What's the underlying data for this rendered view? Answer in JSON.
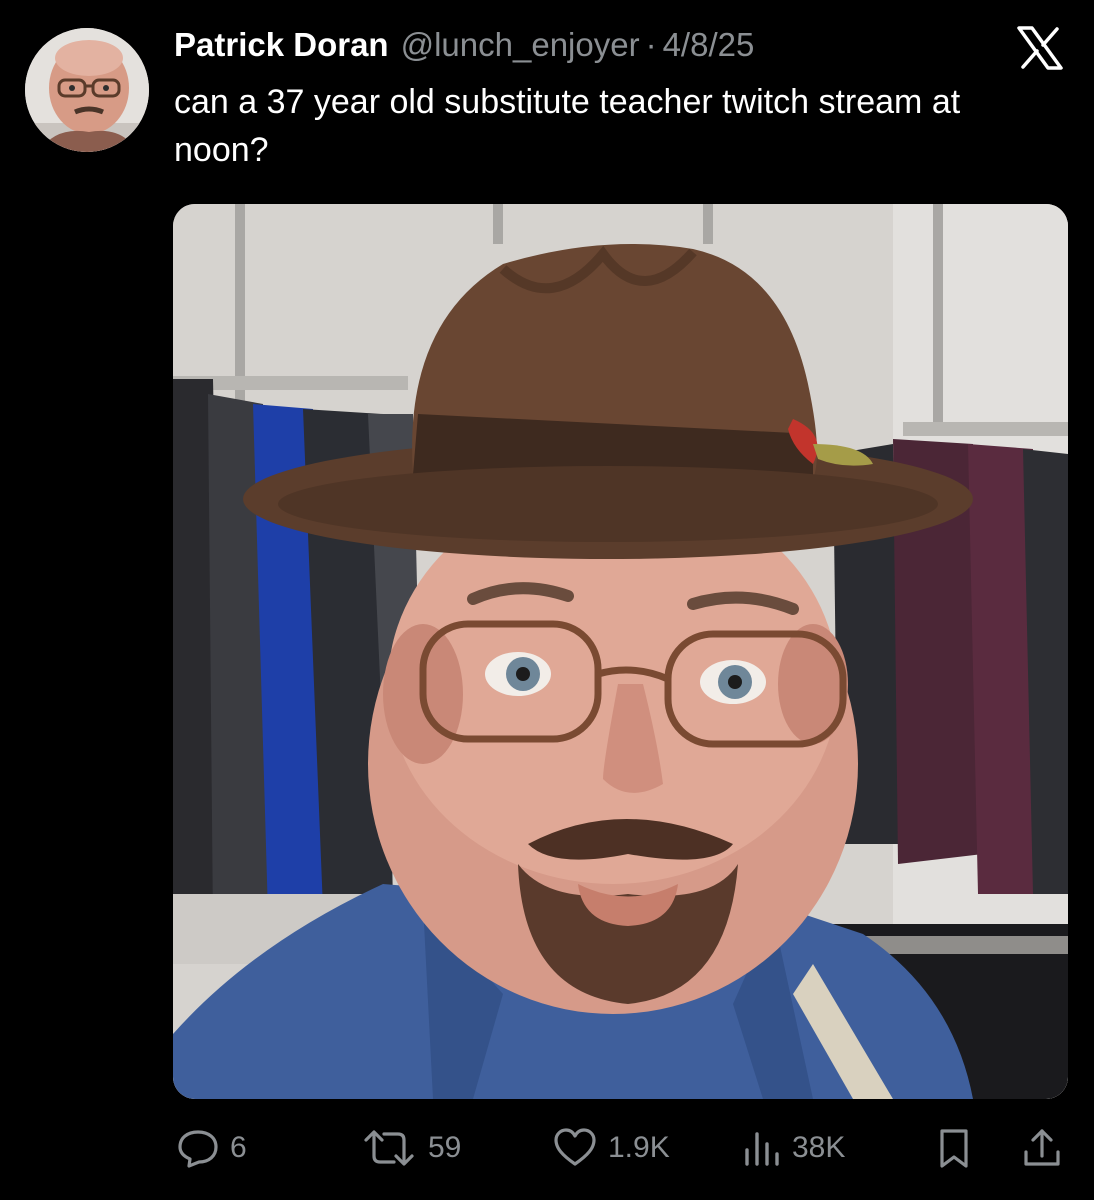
{
  "tweet": {
    "author": {
      "display_name": "Patrick Doran",
      "handle": "@lunch_enjoyer",
      "avatar": "profile-photo"
    },
    "separator": "·",
    "date": "4/8/25",
    "text": "can a 37 year old substitute teacher twitch stream at noon?",
    "media": {
      "type": "photo",
      "description_icon": "selfie-photo"
    },
    "platform_icon": "x-logo-icon"
  },
  "actions": {
    "replies": {
      "icon": "reply-icon",
      "count": "6"
    },
    "reposts": {
      "icon": "repost-icon",
      "count": "59"
    },
    "likes": {
      "icon": "heart-icon",
      "count": "1.9K"
    },
    "views": {
      "icon": "views-icon",
      "count": "38K"
    },
    "bookmark": {
      "icon": "bookmark-icon"
    },
    "share": {
      "icon": "share-icon"
    }
  },
  "colors": {
    "background": "#000000",
    "primary_text": "#ffffff",
    "secondary_text": "#8b8f93"
  }
}
